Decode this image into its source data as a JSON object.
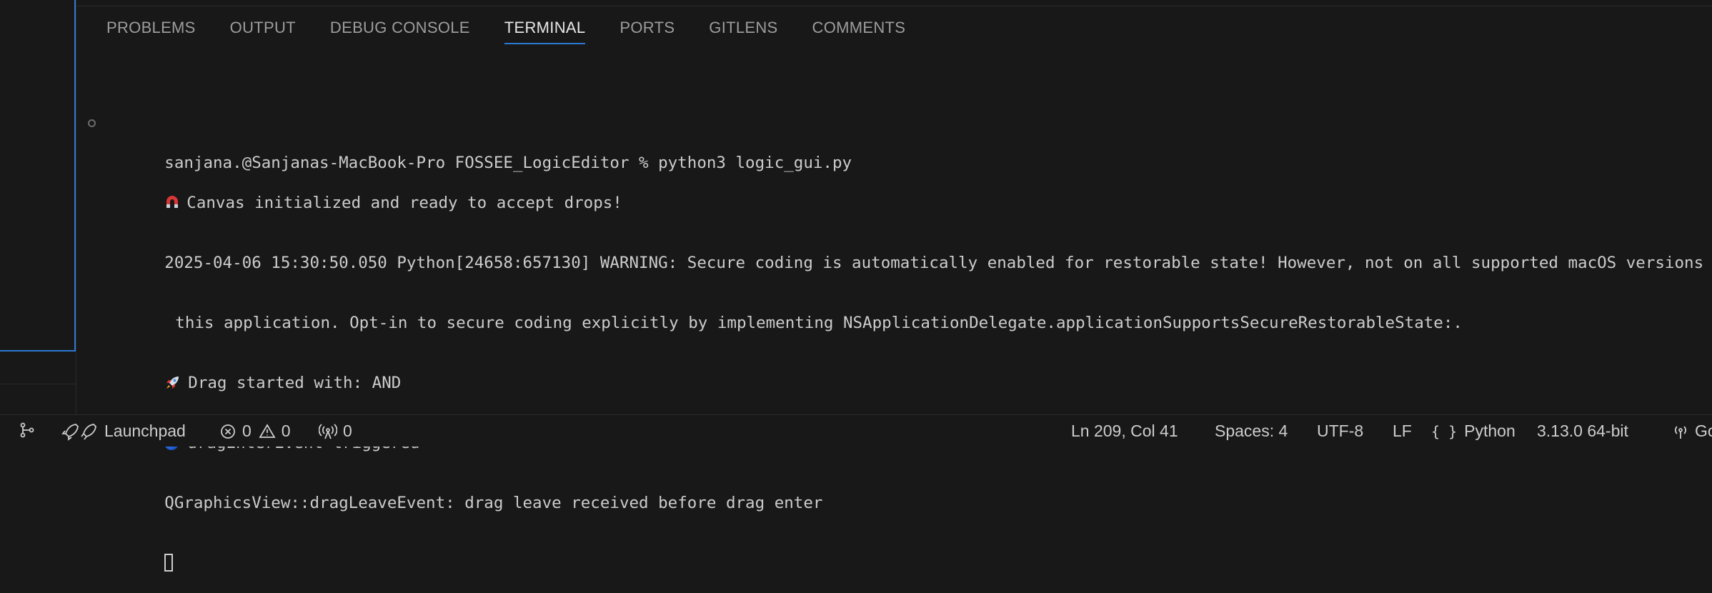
{
  "panel": {
    "tabs": [
      {
        "label": "PROBLEMS"
      },
      {
        "label": "OUTPUT"
      },
      {
        "label": "DEBUG CONSOLE"
      },
      {
        "label": "TERMINAL",
        "active": true
      },
      {
        "label": "PORTS"
      },
      {
        "label": "GITLENS"
      },
      {
        "label": "COMMENTS"
      }
    ]
  },
  "terminal": {
    "command_line": "sanjana.@Sanjanas-MacBook-Pro FOSSEE_LogicEditor % python3 logic_gui.py",
    "line_canvas": "Canvas initialized and ready to accept drops!",
    "line_warning_1": "2025-04-06 15:30:50.050 Python[24658:657130] WARNING: Secure coding is automatically enabled for restorable state! However, not on all supported macOS versions o",
    "line_warning_2": "this application. Opt-in to secure coding explicitly by implementing NSApplicationDelegate.applicationSupportsSecureRestorableState:.",
    "line_drag_start": "Drag started with: AND",
    "line_drag_enter": "dragEnterEvent triggered",
    "line_drag_leave": "QGraphicsView::dragLeaveEvent: drag leave received before drag enter",
    "icons": [
      "magnet-emoji",
      "rocket-emoji",
      "blue-circle-emoji"
    ]
  },
  "statusbar": {
    "launchpad_label": "Launchpad",
    "errors_count": "0",
    "warnings_count": "0",
    "ports_count": "0",
    "cursor_position": "Ln 209, Col 41",
    "indentation": "Spaces: 4",
    "encoding": "UTF-8",
    "eol": "LF",
    "language": "Python",
    "interpreter": "3.13.0 64-bit",
    "go_live": "Go Live"
  },
  "colors": {
    "background": "#181818",
    "accent": "#2b79d3",
    "text": "#cccccc",
    "tab_inactive": "#9d9d9d"
  }
}
